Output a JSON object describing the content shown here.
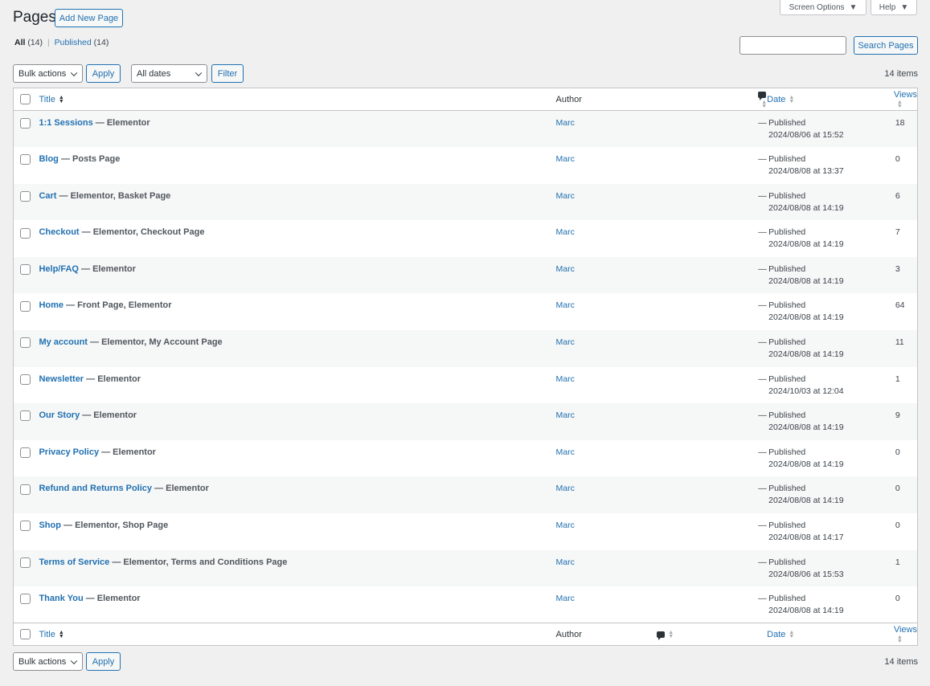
{
  "header": {
    "title": "Pages",
    "add_new": "Add New Page",
    "screen_options": "Screen Options",
    "help": "Help"
  },
  "filters": {
    "all": "All",
    "all_count": "(14)",
    "separator": "|",
    "published": "Published",
    "published_count": "(14)"
  },
  "search": {
    "value": "",
    "button": "Search Pages"
  },
  "toolbar": {
    "bulk_actions": "Bulk actions",
    "apply": "Apply",
    "dates": "All dates",
    "filter": "Filter",
    "items": "14 items"
  },
  "columns": {
    "title": "Title",
    "author": "Author",
    "date": "Date",
    "views": "Views"
  },
  "rows": [
    {
      "title": "1:1 Sessions",
      "states": " — Elementor",
      "author": "Marc",
      "comments": "—",
      "status": "Published",
      "date": "2024/08/06 at 15:52",
      "views": "18"
    },
    {
      "title": "Blog",
      "states": " — Posts Page",
      "author": "Marc",
      "comments": "—",
      "status": "Published",
      "date": "2024/08/08 at 13:37",
      "views": "0"
    },
    {
      "title": "Cart",
      "states": " — Elementor, Basket Page",
      "author": "Marc",
      "comments": "—",
      "status": "Published",
      "date": "2024/08/08 at 14:19",
      "views": "6"
    },
    {
      "title": "Checkout",
      "states": " — Elementor, Checkout Page",
      "author": "Marc",
      "comments": "—",
      "status": "Published",
      "date": "2024/08/08 at 14:19",
      "views": "7"
    },
    {
      "title": "Help/FAQ",
      "states": " — Elementor",
      "author": "Marc",
      "comments": "—",
      "status": "Published",
      "date": "2024/08/08 at 14:19",
      "views": "3"
    },
    {
      "title": "Home",
      "states": " — Front Page, Elementor",
      "author": "Marc",
      "comments": "—",
      "status": "Published",
      "date": "2024/08/08 at 14:19",
      "views": "64"
    },
    {
      "title": "My account",
      "states": " — Elementor, My Account Page",
      "author": "Marc",
      "comments": "—",
      "status": "Published",
      "date": "2024/08/08 at 14:19",
      "views": "11"
    },
    {
      "title": "Newsletter",
      "states": " — Elementor",
      "author": "Marc",
      "comments": "—",
      "status": "Published",
      "date": "2024/10/03 at 12:04",
      "views": "1"
    },
    {
      "title": "Our Story",
      "states": " — Elementor",
      "author": "Marc",
      "comments": "—",
      "status": "Published",
      "date": "2024/08/08 at 14:19",
      "views": "9"
    },
    {
      "title": "Privacy Policy",
      "states": " — Elementor",
      "author": "Marc",
      "comments": "—",
      "status": "Published",
      "date": "2024/08/08 at 14:19",
      "views": "0"
    },
    {
      "title": "Refund and Returns Policy",
      "states": " — Elementor",
      "author": "Marc",
      "comments": "—",
      "status": "Published",
      "date": "2024/08/08 at 14:19",
      "views": "0"
    },
    {
      "title": "Shop",
      "states": " — Elementor, Shop Page",
      "author": "Marc",
      "comments": "—",
      "status": "Published",
      "date": "2024/08/08 at 14:17",
      "views": "0"
    },
    {
      "title": "Terms of Service",
      "states": " — Elementor, Terms and Conditions Page",
      "author": "Marc",
      "comments": "—",
      "status": "Published",
      "date": "2024/08/06 at 15:53",
      "views": "1"
    },
    {
      "title": "Thank You",
      "states": " — Elementor",
      "author": "Marc",
      "comments": "—",
      "status": "Published",
      "date": "2024/08/08 at 14:19",
      "views": "0"
    }
  ]
}
